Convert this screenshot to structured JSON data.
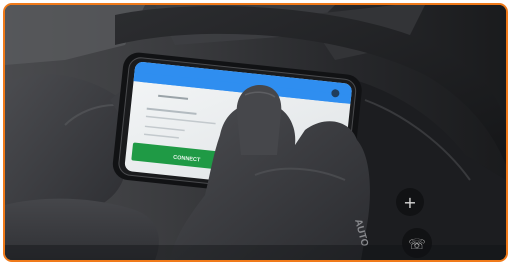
{
  "photo": {
    "subject": "phone-on-steering-wheel",
    "accent_border_color": "#f07a1a"
  },
  "phone": {
    "screen": {
      "header_color": "#2f8ef0",
      "connect_button": {
        "label": "CONNECT",
        "color": "#1f9a45"
      }
    }
  },
  "glove": {
    "brand_text": "AUTO"
  },
  "steering_wheel": {
    "control_plus_icon": "plus-icon",
    "control_phone_icon": "phone-hangup-icon"
  }
}
